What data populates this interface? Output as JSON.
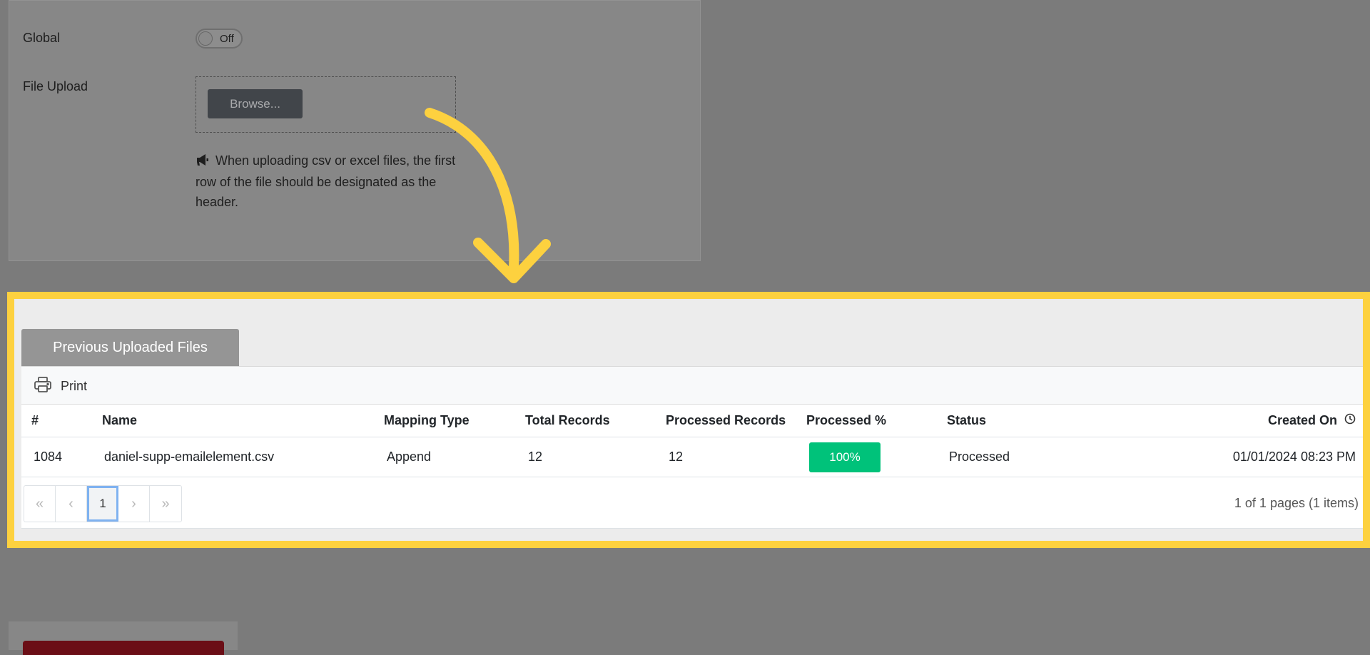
{
  "form": {
    "global_label": "Global",
    "toggle_text": "Off",
    "file_upload_label": "File Upload",
    "browse_label": "Browse...",
    "note": "When uploading csv or excel files, the first row of the file should be designated as the header."
  },
  "panel": {
    "tab_label": "Previous Uploaded Files",
    "print_label": "Print",
    "columns": [
      "#",
      "Name",
      "Mapping Type",
      "Total Records",
      "Processed Records",
      "Processed %",
      "Status",
      "Created On"
    ],
    "rows": [
      {
        "id": "1084",
        "name": "daniel-supp-emailelement.csv",
        "mapping_type": "Append",
        "total_records": "12",
        "processed_records": "12",
        "processed_pct": "100%",
        "status": "Processed",
        "created_on": "01/01/2024 08:23 PM"
      }
    ],
    "pager": {
      "first": "«",
      "prev": "‹",
      "current": "1",
      "next": "›",
      "last": "»",
      "info": "1 of 1 pages (1 items)"
    }
  },
  "colors": {
    "highlight": "#fdd13f",
    "badge_success": "#00c27a",
    "overlay": "#7b7b7b"
  },
  "icons": [
    "megaphone-icon",
    "printer-icon",
    "clock-icon",
    "arrow-annotation"
  ]
}
